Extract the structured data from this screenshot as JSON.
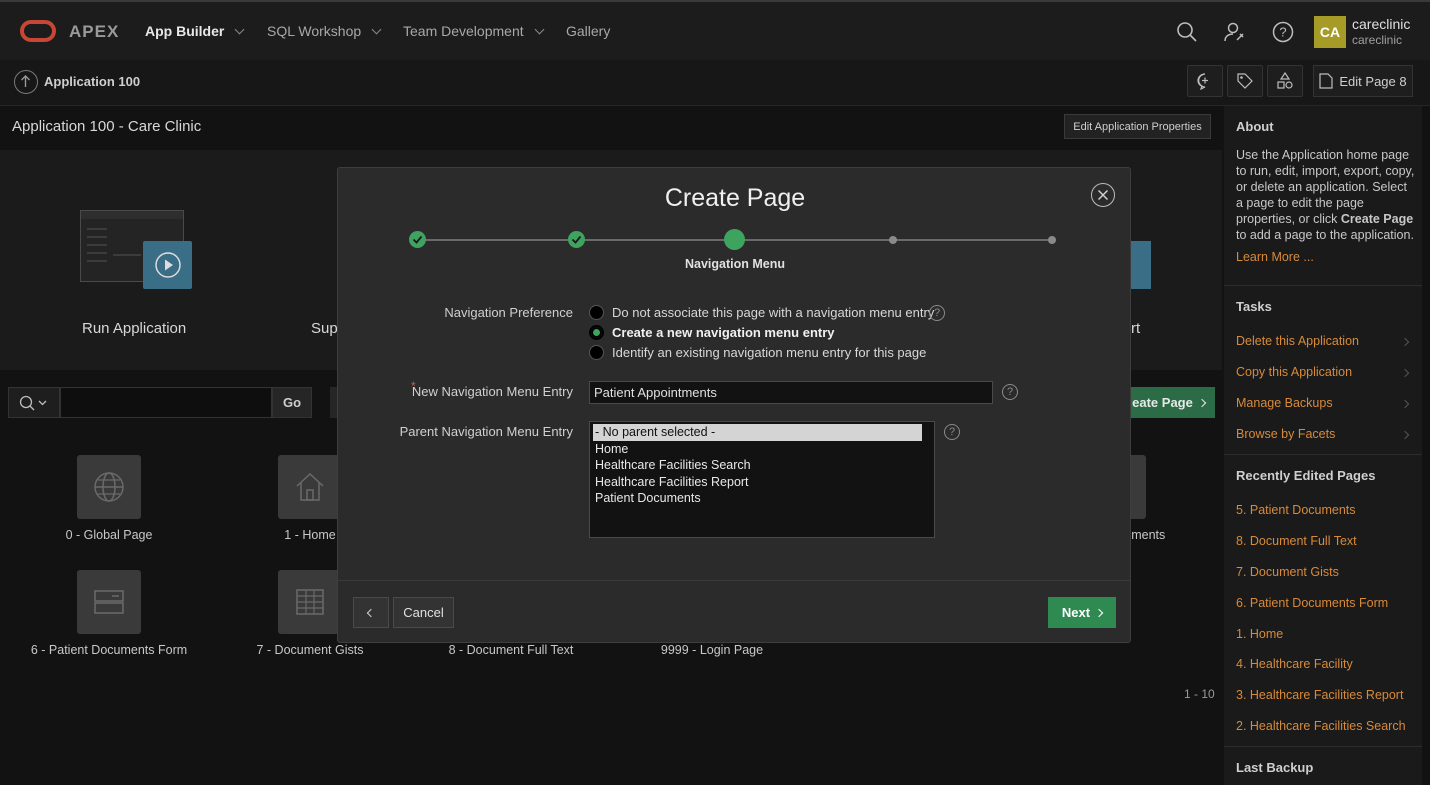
{
  "header": {
    "brand": "APEX",
    "nav": [
      "App Builder",
      "SQL Workshop",
      "Team Development",
      "Gallery"
    ],
    "avatar_initials": "CA",
    "user_name": "careclinic",
    "user_workspace": "careclinic"
  },
  "subbar": {
    "breadcrumb": "Application 100",
    "edit_page": "Edit Page 8"
  },
  "main": {
    "app_title": "Application 100 - Care Clinic",
    "edit_properties": "Edit Application Properties",
    "hero": {
      "run_label": "Run Application",
      "supporting_label": "Sup",
      "export_label": "rt"
    },
    "search_go": "Go",
    "create_page": "eate Page",
    "pages": [
      {
        "label": "0 - Global Page",
        "icon": "globe-icon"
      },
      {
        "label": "1 - Home",
        "icon": "home-icon"
      },
      {
        "label": "cuments",
        "icon": "document-icon"
      },
      {
        "label": "6 - Patient Documents Form",
        "icon": "form-icon"
      },
      {
        "label": "7 - Document Gists",
        "icon": "grid-icon"
      },
      {
        "label": "8 - Document Full Text",
        "icon": "document-icon"
      },
      {
        "label": "9999 - Login Page",
        "icon": "login-icon"
      }
    ],
    "pagination": "1 - 10"
  },
  "sidebar": {
    "about_heading": "About",
    "about_text_1": "Use the Application home page to run, edit, import, export, copy, or delete an application. Select a page to edit the page properties, or click ",
    "about_text_bold": "Create Page",
    "about_text_2": " to add a page to the application.",
    "learn_more": "Learn More ...",
    "tasks_heading": "Tasks",
    "tasks": [
      "Delete this Application",
      "Copy this Application",
      "Manage Backups",
      "Browse by Facets"
    ],
    "recent_heading": "Recently Edited Pages",
    "recent": [
      "5. Patient Documents",
      "8. Document Full Text",
      "7. Document Gists",
      "6. Patient Documents Form",
      "1. Home",
      "4. Healthcare Facility",
      "3. Healthcare Facilities Report",
      "2. Healthcare Facilities Search"
    ],
    "backup_heading": "Last Backup"
  },
  "dialog": {
    "title": "Create Page",
    "step_label": "Navigation Menu",
    "nav_pref_label": "Navigation Preference",
    "radio_options": [
      "Do not associate this page with a navigation menu entry",
      "Create a new navigation menu entry",
      "Identify an existing navigation menu entry for this page"
    ],
    "new_entry_label": "New Navigation Menu Entry",
    "new_entry_value": "Patient Appointments",
    "parent_label": "Parent Navigation Menu Entry",
    "parent_options": [
      "- No parent selected -",
      "Home",
      "Healthcare Facilities Search",
      "Healthcare Facilities Report",
      "Patient Documents"
    ],
    "required_marker": "*",
    "help_glyph": "?",
    "cancel": "Cancel",
    "next": "Next"
  },
  "colors": {
    "accent_green": "#2f8a52",
    "link_orange": "#d88a3a",
    "oracle_red": "#c74634"
  }
}
